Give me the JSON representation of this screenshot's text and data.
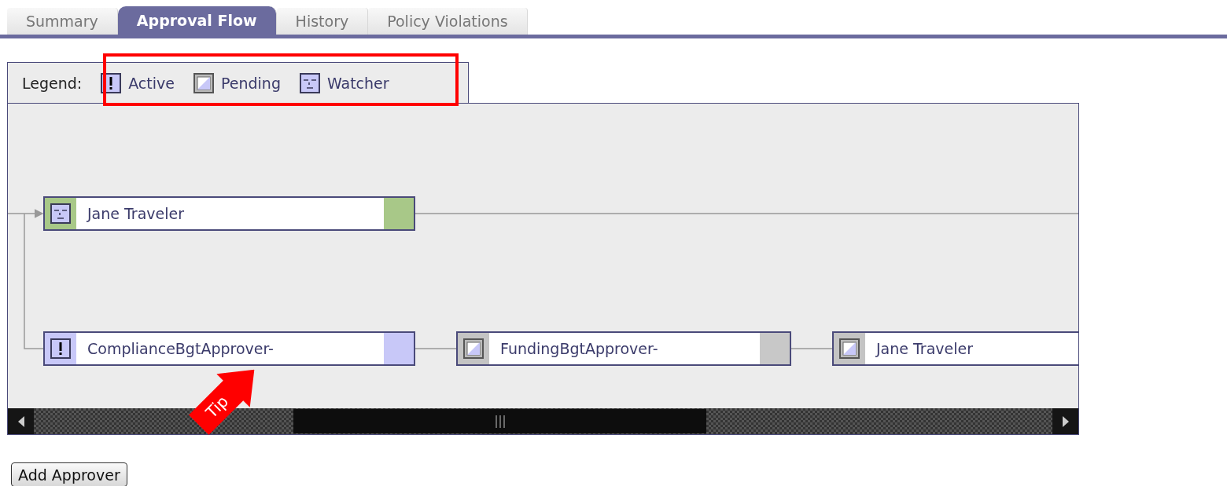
{
  "tabs": [
    {
      "label": "Summary",
      "selected": false
    },
    {
      "label": "Approval Flow",
      "selected": true
    },
    {
      "label": "History",
      "selected": false
    },
    {
      "label": "Policy Violations",
      "selected": false
    }
  ],
  "legend": {
    "label": "Legend:",
    "items": [
      {
        "kind": "active",
        "label": "Active"
      },
      {
        "kind": "pending",
        "label": "Pending"
      },
      {
        "kind": "watcher",
        "label": "Watcher"
      }
    ]
  },
  "flow": {
    "nodes": [
      {
        "kind": "watcher",
        "name": "Jane Traveler",
        "color": "#a8c888"
      },
      {
        "kind": "active",
        "name": "ComplianceBgtApprover-",
        "color": "#c8c8f8"
      },
      {
        "kind": "pending",
        "name": "FundingBgtApprover-",
        "color": "#c8c8c8"
      },
      {
        "kind": "pending",
        "name": "Jane Traveler"
      }
    ]
  },
  "annotation": {
    "label": "Tip"
  },
  "buttons": [
    "Add Approver"
  ]
}
